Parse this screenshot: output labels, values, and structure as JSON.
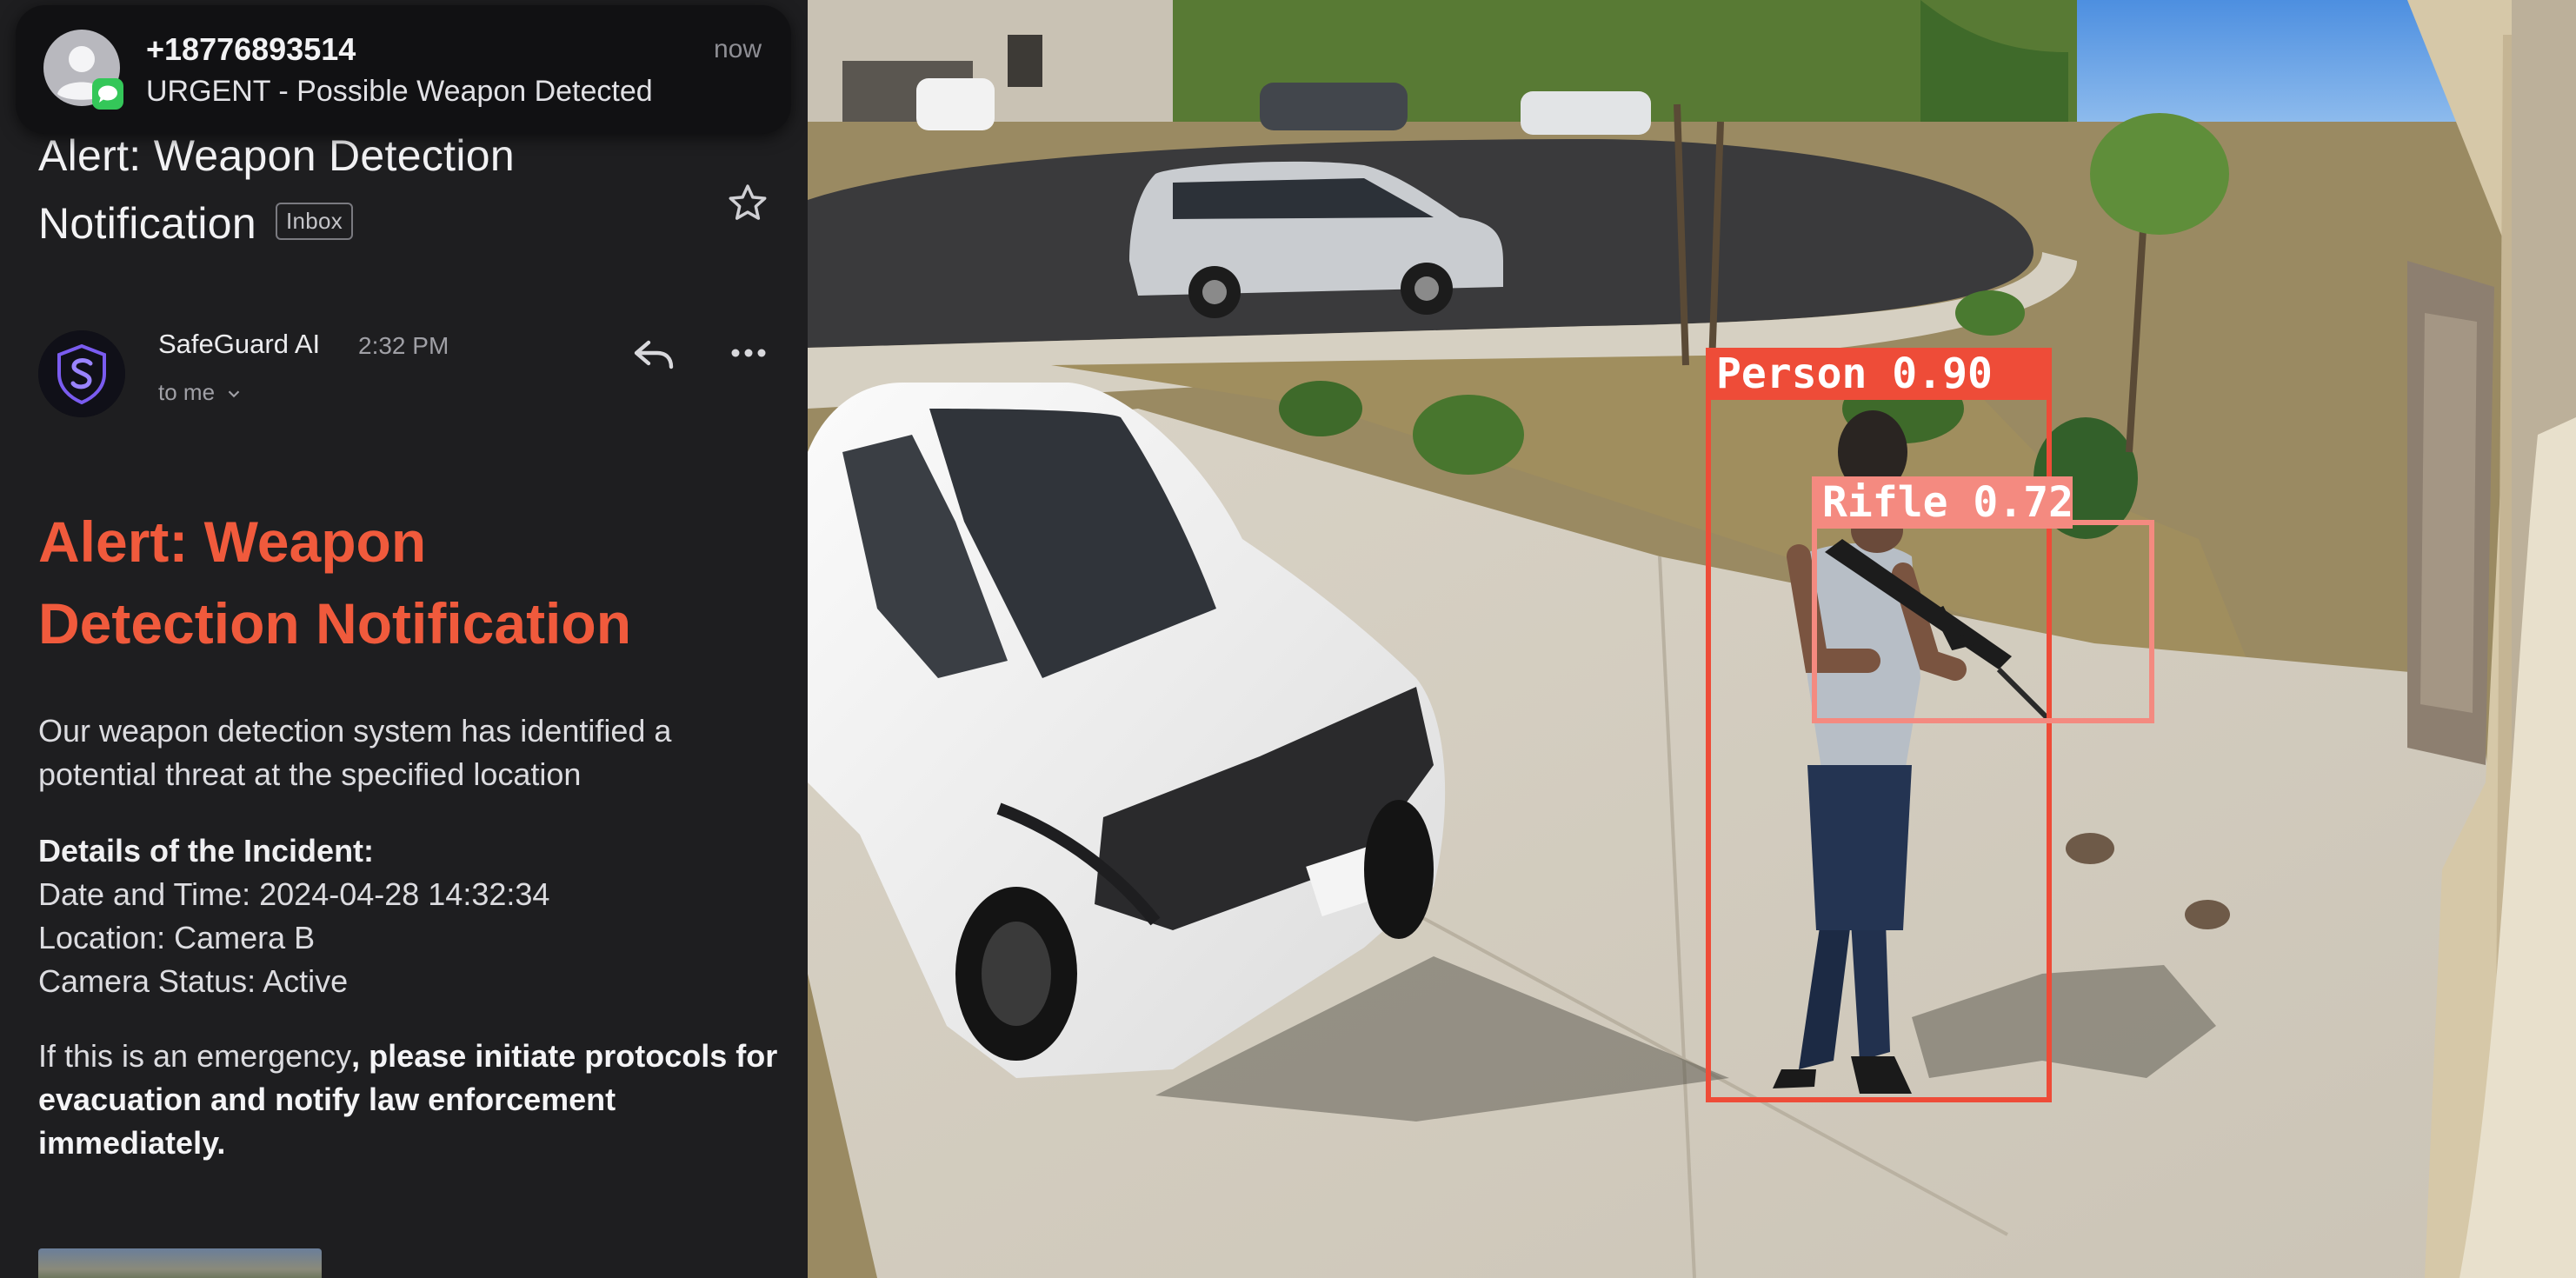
{
  "notification": {
    "sender": "+18776893514",
    "time": "now",
    "message": "URGENT - Possible Weapon Detected",
    "icons": [
      "contact-avatar-icon",
      "messages-app-icon"
    ]
  },
  "email": {
    "subject_line1": "Alert: Weapon Detection",
    "subject_line2": "Notification",
    "folder_badge": "Inbox",
    "sender_name": "SafeGuard AI",
    "sent_time": "2:32 PM",
    "recipient": "to me",
    "alert_title_line1": "Alert: Weapon",
    "alert_title_line2": "Detection Notification",
    "intro_text": "Our weapon detection system has identified a potential threat at the specified location",
    "details_heading": "Details of the Incident:",
    "details_date": "Date and Time: 2024-04-28 14:32:34",
    "details_location": "Location: Camera B",
    "details_status": "Camera Status: Active",
    "emergency_plain": "If this is an emergency",
    "emergency_bold": ", please initiate protocols for evacuation and notify law enforcement immediately.",
    "icons": [
      "star-icon",
      "reply-icon",
      "more-options-icon",
      "safeguard-logo-icon",
      "chevron-down-icon"
    ]
  },
  "camera": {
    "detections": [
      {
        "label": "Person",
        "confidence": "0.90"
      },
      {
        "label": "Rifle",
        "confidence": "0.72"
      }
    ]
  },
  "colors": {
    "alert_accent": "#f05a3c",
    "person_box": "#ee4c38",
    "rifle_box": "#f48a80",
    "panel_bg": "#1e1e20"
  }
}
